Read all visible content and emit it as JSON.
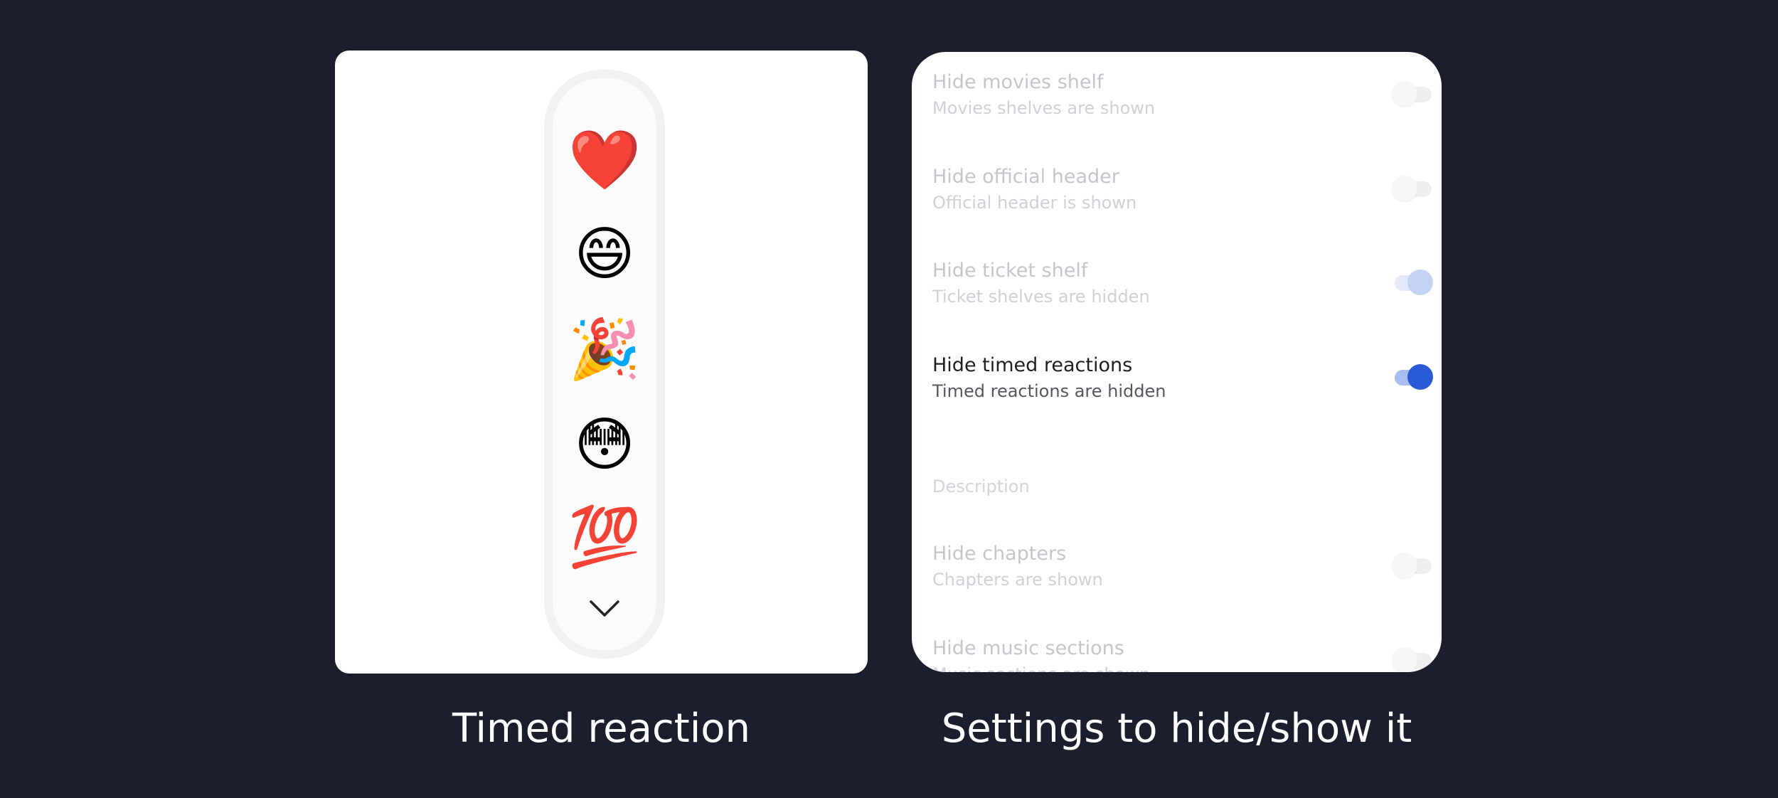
{
  "reaction_panel": {
    "emojis": [
      {
        "name": "red-heart",
        "glyph": "❤️"
      },
      {
        "name": "grinning-face-with-smiling-eyes",
        "glyph": "😄"
      },
      {
        "name": "party-popper",
        "glyph": "🎉"
      },
      {
        "name": "flushed-face",
        "glyph": "😳"
      },
      {
        "name": "hundred-points",
        "glyph": "💯"
      }
    ],
    "collapse_icon": "chevron-down-icon",
    "caption": "Timed reaction"
  },
  "settings_panel": {
    "items": [
      {
        "title": "Hide movies shelf",
        "subtitle": "Movies shelves are shown",
        "enabled": false
      },
      {
        "title": "Hide official header",
        "subtitle": "Official header is shown",
        "enabled": false
      },
      {
        "title": "Hide ticket shelf",
        "subtitle": "Ticket shelves are hidden",
        "enabled": true
      },
      {
        "title": "Hide timed reactions",
        "subtitle": "Timed reactions are hidden",
        "enabled": true
      }
    ],
    "section_header": "Description",
    "section_items": [
      {
        "title": "Hide chapters",
        "subtitle": "Chapters are shown",
        "enabled": false
      },
      {
        "title": "Hide music sections",
        "subtitle": "Music sections are shown",
        "enabled": false
      }
    ],
    "caption": "Settings to hide/show it"
  },
  "colors": {
    "background": "#1b1f2d",
    "toggle_on_active": "#2a5bd7",
    "toggle_on_dimmed": "#c4d2f3",
    "toggle_track_on_active": "#a9bdf0",
    "toggle_track_on_dimmed": "#e3e9f8"
  }
}
